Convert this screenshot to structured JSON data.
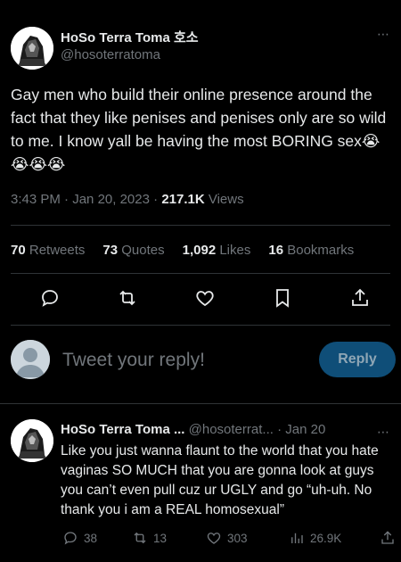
{
  "tweet": {
    "display_name": "HoSo Terra Toma 호소",
    "handle": "@hosoterratoma",
    "more_icon": "⋯",
    "text": "Gay men who build their online presence around the fact that they like penises and penises only are so wild to me. I know yall be having the most BORING sex😭😭😭😭",
    "time": "3:43 PM",
    "date": "Jan 20, 2023",
    "views_count": "217.1K",
    "views_label": "Views"
  },
  "stats": {
    "retweets_count": "70",
    "retweets_label": "Retweets",
    "quotes_count": "73",
    "quotes_label": "Quotes",
    "likes_count": "1,092",
    "likes_label": "Likes",
    "bookmarks_count": "16",
    "bookmarks_label": "Bookmarks"
  },
  "actions": [
    "reply-icon",
    "retweet-icon",
    "like-icon",
    "bookmark-icon",
    "share-icon"
  ],
  "composer": {
    "placeholder": "Tweet your reply!",
    "reply_button": "Reply"
  },
  "reply": {
    "display_name": "HoSo Terra Toma ...",
    "handle": "@hosoterrat...",
    "date": "Jan 20",
    "more_icon": "⋯",
    "text": "Like you just wanna flaunt to the world that you hate vaginas SO MUCH that you are gonna look at guys you can’t even pull cuz ur UGLY and go “uh-uh. No thank you i am a REAL homosexual”",
    "replies": "38",
    "retweets": "13",
    "likes": "303",
    "views": "26.9K"
  },
  "colors": {
    "background": "#000000",
    "text": "#e7e9ea",
    "muted": "#71767b",
    "divider": "#2f3336",
    "reply_button": "#0f4e78"
  }
}
